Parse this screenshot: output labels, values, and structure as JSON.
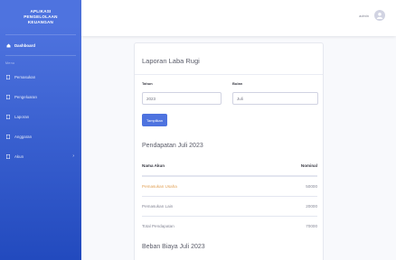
{
  "sidebar": {
    "brand": [
      "APLIKASI",
      "PENGELOLAAN",
      "KEUANGAN"
    ],
    "dashboard": "Dashboard",
    "heading": "Menu",
    "items": [
      {
        "label": "Pemasukan"
      },
      {
        "label": "Pengeluaran"
      },
      {
        "label": "Laporan"
      },
      {
        "label": "Anggaran"
      },
      {
        "label": "Akun"
      }
    ]
  },
  "topbar": {
    "user_name": "admin"
  },
  "report": {
    "title": "Laporan Laba Rugi",
    "form": {
      "year_label": "Tahun",
      "year_value": "2023",
      "month_label": "Bulan",
      "month_value": "Juli",
      "submit_label": "Tampilkan"
    },
    "income_section": {
      "title": "Pendapatan Juli 2023",
      "headers": [
        "Nama Akun",
        "Nominal"
      ],
      "rows": [
        {
          "name": "Pemasukan Usaha",
          "amount": "50000"
        },
        {
          "name": "Pemasukan Lain",
          "amount": "20000"
        },
        {
          "name": "Total Pendapatan",
          "amount": "70000"
        }
      ]
    },
    "expense_section": {
      "title": "Beban Biaya Juli 2023"
    }
  }
}
